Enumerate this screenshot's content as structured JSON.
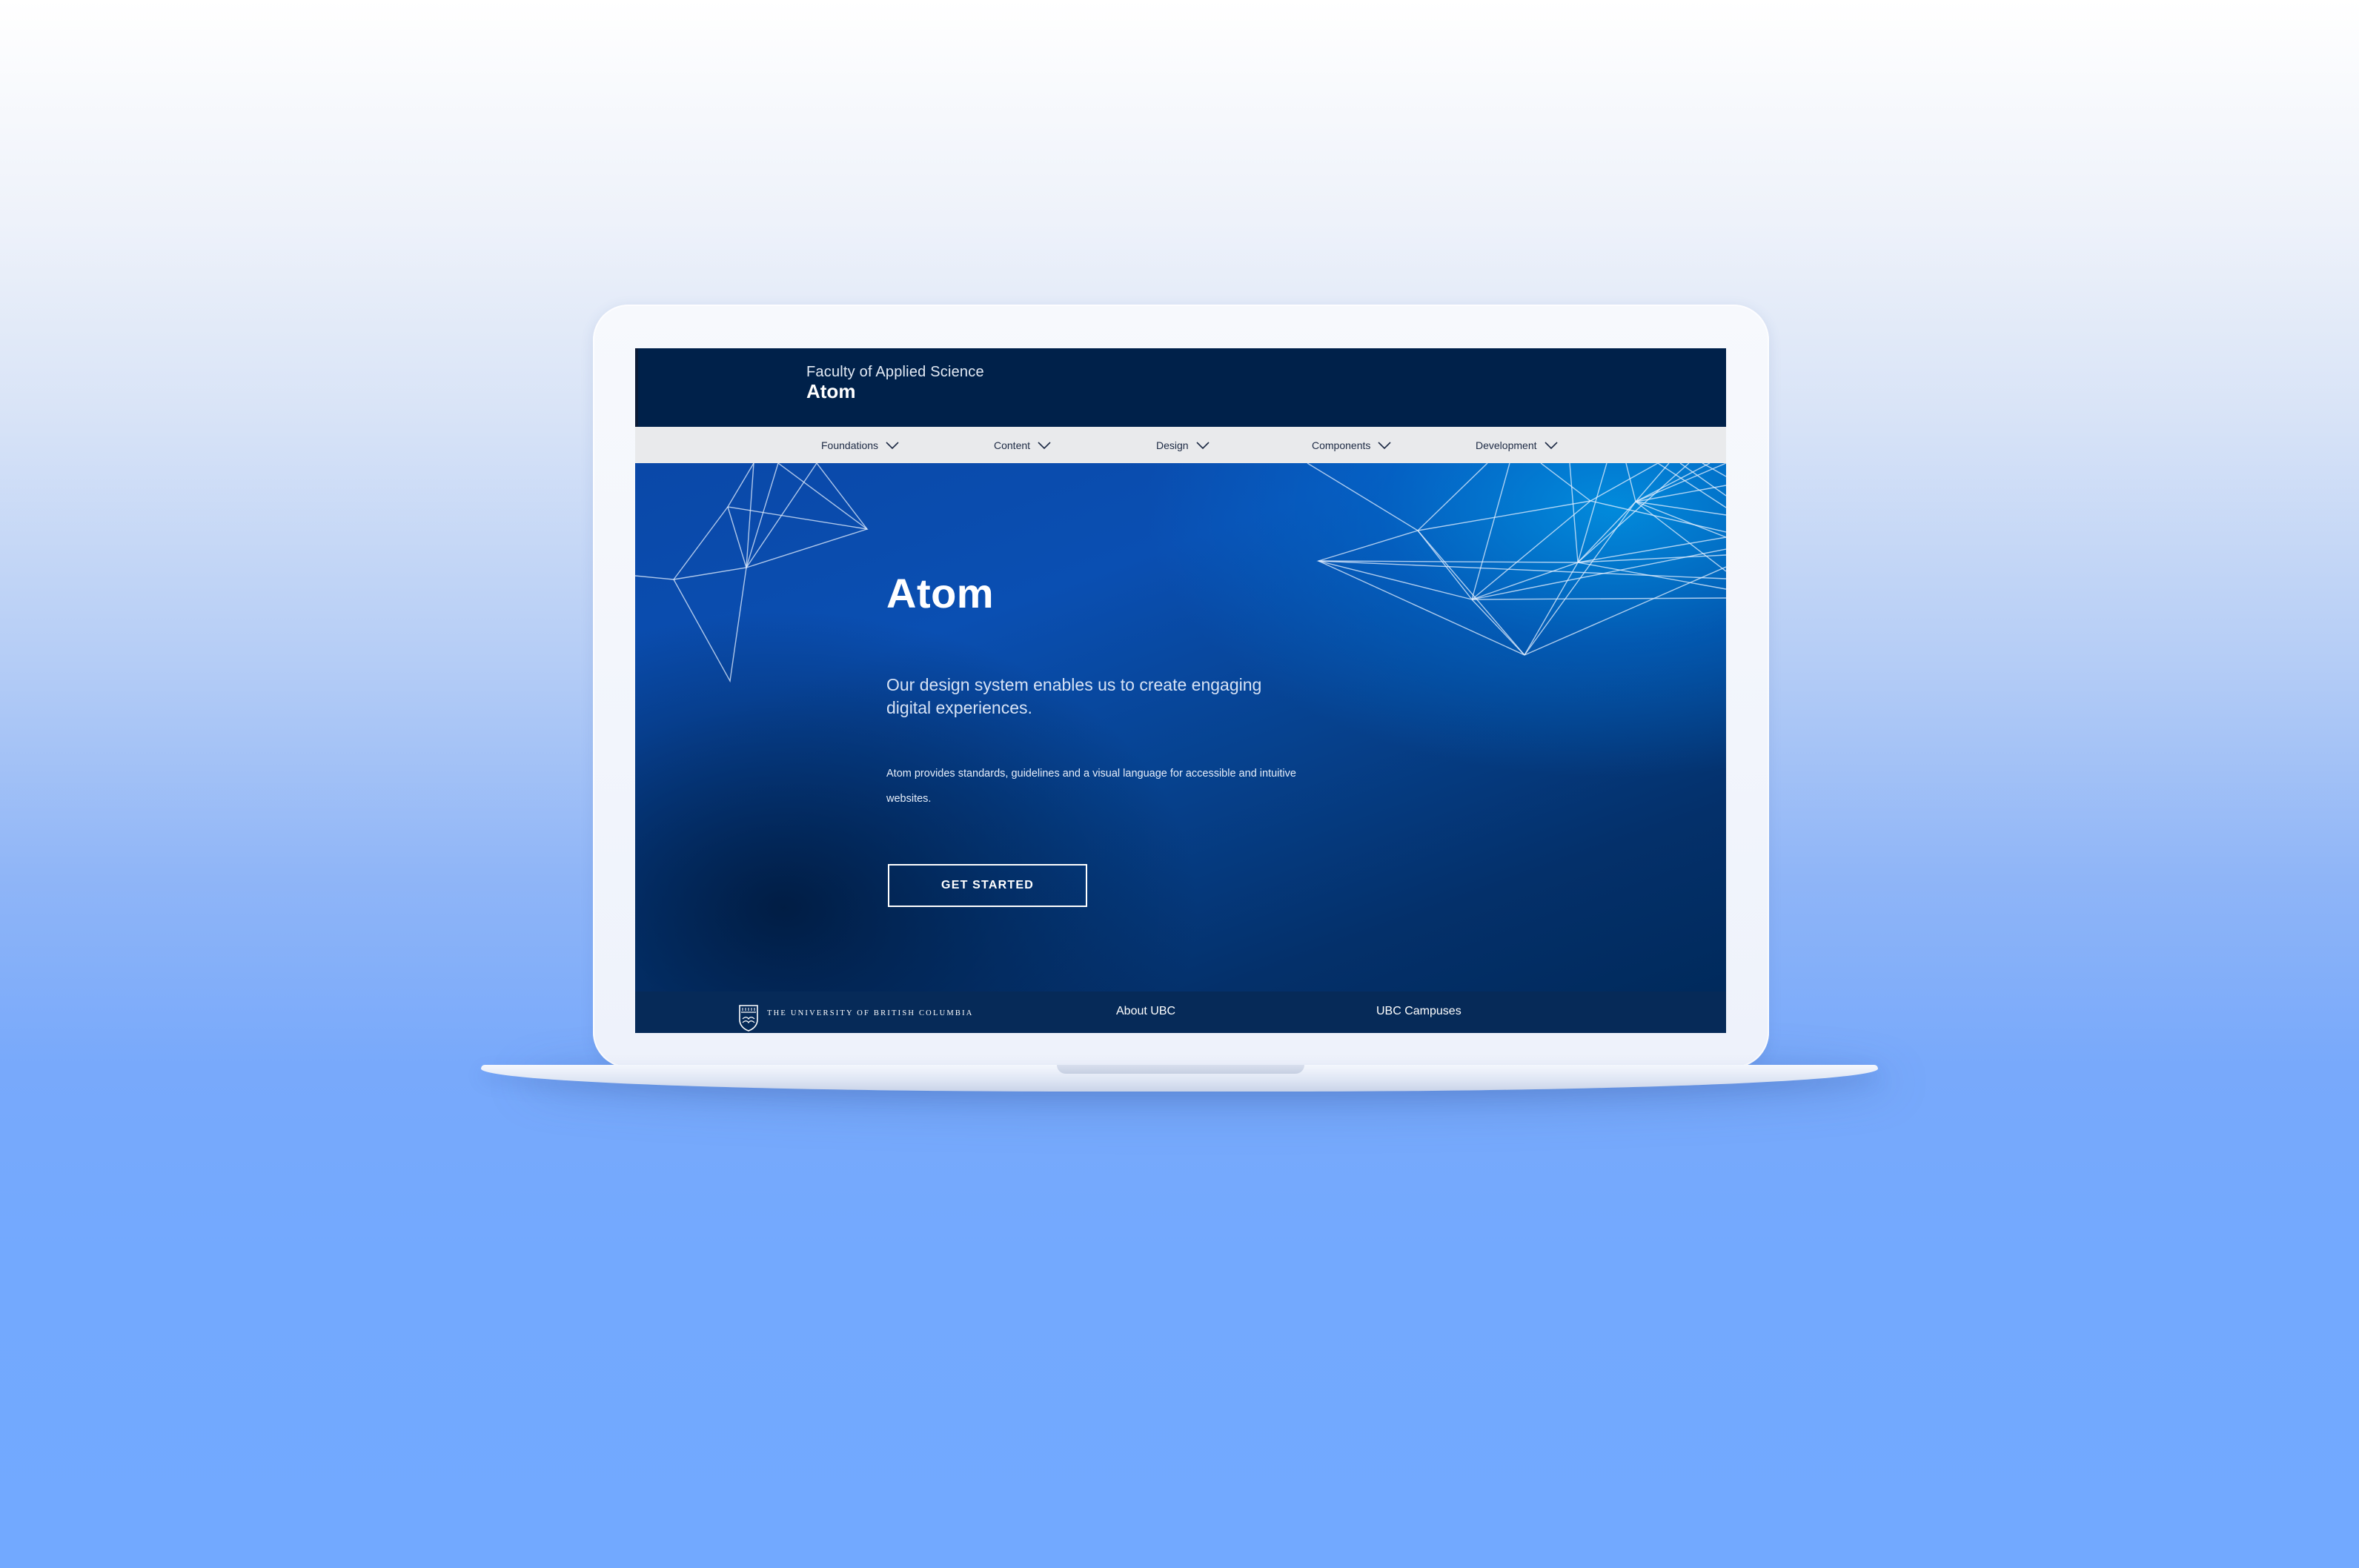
{
  "header": {
    "faculty": "Faculty of Applied Science",
    "site_title": "Atom"
  },
  "nav": {
    "items": [
      {
        "label": "Foundations",
        "icon": "chevron-down-icon"
      },
      {
        "label": "Content",
        "icon": "chevron-down-icon"
      },
      {
        "label": "Design",
        "icon": "chevron-down-icon"
      },
      {
        "label": "Components",
        "icon": "chevron-down-icon"
      },
      {
        "label": "Development",
        "icon": "chevron-down-icon"
      }
    ]
  },
  "hero": {
    "title": "Atom",
    "lead": "Our design system enables us to create engaging digital experiences.",
    "body": "Atom provides standards, guidelines and a visual language for accessible and intuitive websites.",
    "cta_label": "GET STARTED",
    "decoration": "network-lines"
  },
  "footer": {
    "university": "THE UNIVERSITY OF BRITISH COLUMBIA",
    "logo": "ubc-crest-icon",
    "links": [
      {
        "label": "About UBC"
      },
      {
        "label": "UBC Campuses"
      }
    ]
  },
  "colors": {
    "page_bg_top": "#ffffff",
    "page_bg_bottom": "#72a9ff",
    "header_bg": "#00214a",
    "nav_bg": "#e9eaec",
    "hero_accent": "#0a4fb2",
    "footer_bg": "#062a58"
  }
}
